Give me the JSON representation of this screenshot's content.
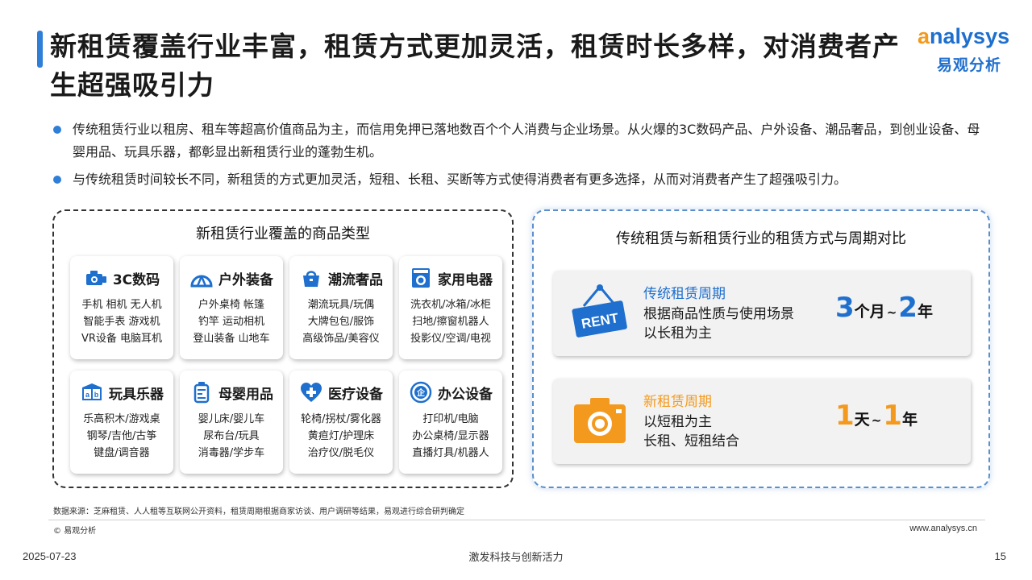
{
  "title": "新租赁覆盖行业丰富，租赁方式更加灵活，租赁时长多样，对消费者产生超强吸引力",
  "logo": {
    "en_prefix": "a",
    "en_rest": "nalysys",
    "cn": "易观分析"
  },
  "bullets": [
    "传统租赁行业以租房、租车等超高价值商品为主，而信用免押已落地数百个个人消费与企业场景。从火爆的3C数码产品、户外设备、潮品奢品，到创业设备、母婴用品、玩具乐器，都彰显出新租赁行业的蓬勃生机。",
    "与传统租赁时间较长不同，新租赁的方式更加灵活，短租、长租、买断等方式使得消费者有更多选择，从而对消费者产生了超强吸引力。"
  ],
  "left_panel": {
    "title": "新租赁行业覆盖的商品类型",
    "categories": [
      {
        "name": "3C数码",
        "icon": "camera-icon",
        "lines": [
          "手机 相机 无人机",
          "智能手表 游戏机",
          "VR设备 电脑耳机"
        ]
      },
      {
        "name": "户外装备",
        "icon": "tent-icon",
        "lines": [
          "户外桌椅 帐篷",
          "钓竿 运动相机",
          "登山装备 山地车"
        ]
      },
      {
        "name": "潮流奢品",
        "icon": "handbag-icon",
        "lines": [
          "潮流玩具/玩偶",
          "大牌包包/服饰",
          "高级饰品/美容仪"
        ]
      },
      {
        "name": "家用电器",
        "icon": "washing-machine-icon",
        "lines": [
          "洗衣机/冰箱/冰柜",
          "扫地/擦窗机器人",
          "投影仪/空调/电视"
        ]
      },
      {
        "name": "玩具乐器",
        "icon": "toy-blocks-icon",
        "lines": [
          "乐高积木/游戏桌",
          "钢琴/吉他/古筝",
          "键盘/调音器"
        ]
      },
      {
        "name": "母婴用品",
        "icon": "baby-bottle-icon",
        "lines": [
          "婴儿床/婴儿车",
          "尿布台/玩具",
          "消毒器/学步车"
        ]
      },
      {
        "name": "医疗设备",
        "icon": "medical-heart-icon",
        "lines": [
          "轮椅/拐杖/雾化器",
          "黄疸灯/护理床",
          "治疗仪/脱毛仪"
        ]
      },
      {
        "name": "办公设备",
        "icon": "office-badge-icon",
        "lines": [
          "打印机/电脑",
          "办公桌椅/显示器",
          "直播灯具/机器人"
        ]
      }
    ],
    "icon_glyphs": {
      "toy": "a b",
      "office": "企"
    }
  },
  "right_panel": {
    "title": "传统租赁与新租赁行业的租赁方式与周期对比",
    "traditional": {
      "label": "传统租赁周期",
      "desc": [
        "根据商品性质与使用场景",
        "以长租为主"
      ],
      "icon": "rent-sign-icon",
      "sign_text": "RENT",
      "from_num": "3",
      "from_unit": "个月",
      "tilde": "~",
      "to_num": "2",
      "to_unit": "年",
      "accent": "#1e6fce"
    },
    "new": {
      "label": "新租赁周期",
      "desc": [
        "以短租为主",
        "长租、短租结合"
      ],
      "icon": "camera-icon",
      "from_num": "1",
      "from_unit": "天",
      "tilde": "~",
      "to_num": "1",
      "to_unit": "年",
      "accent": "#f39a1e"
    }
  },
  "footer": {
    "source": "数据来源：芝麻租赁、人人租等互联网公开资料，租赁周期根据商家访谈、用户调研等结果，易观进行综合研判确定",
    "copyright": "© 易观分析",
    "website": "www.analysys.cn",
    "date": "2025-07-23",
    "slogan": "激发科技与创新活力",
    "page": "15"
  },
  "colors": {
    "blue": "#1e6fce",
    "orange": "#f39a1e",
    "title_bar": "#2f7fd8"
  }
}
